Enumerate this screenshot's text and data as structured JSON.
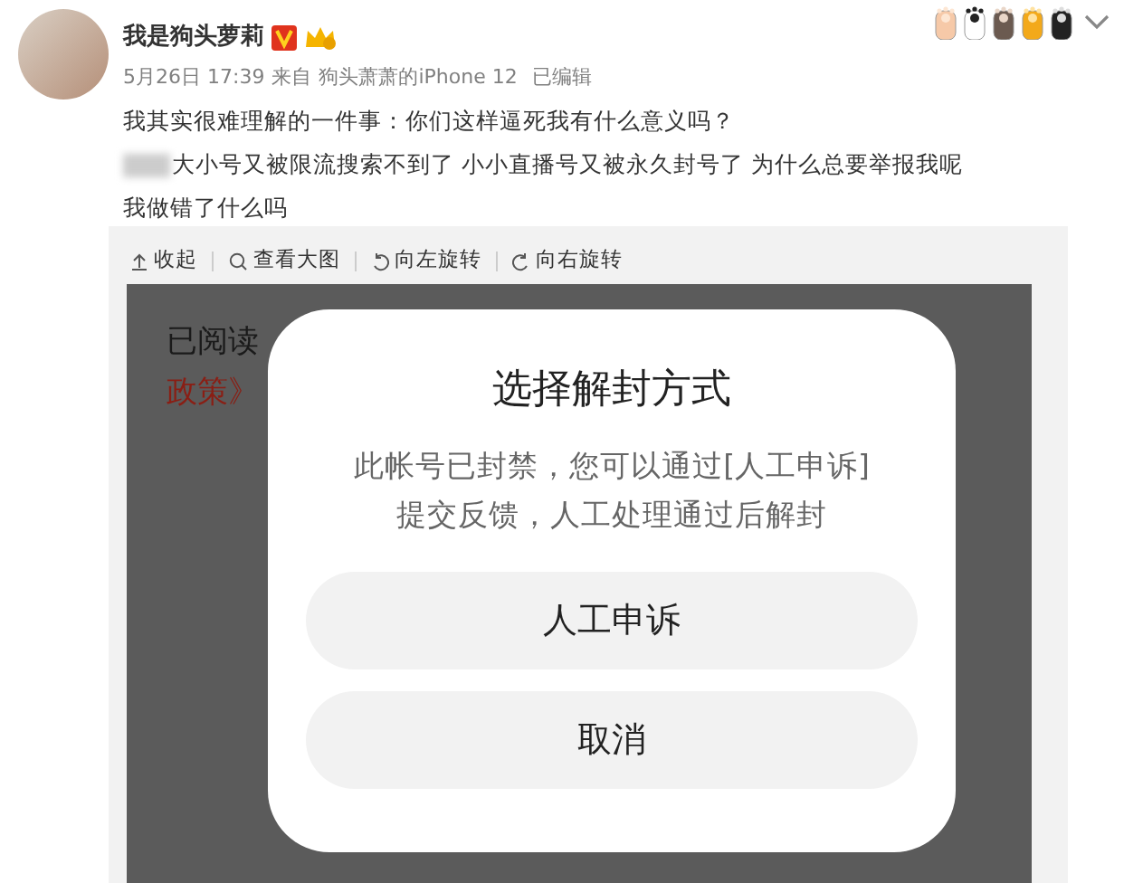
{
  "post": {
    "author": "我是狗头萝莉",
    "time": "5月26日 17:39",
    "source_prefix": "来自",
    "source": "狗头萧萧的iPhone 12",
    "edited": "已编辑",
    "lines": [
      "我其实很难理解的一件事：你们这样逼死我有什么意义吗？",
      "大小号又被限流搜索不到了 小小直播号又被永久封号了 为什么总要举报我呢",
      "我做错了什么吗"
    ]
  },
  "toolbar": [
    "收起",
    "查看大图",
    "向左旋转",
    "向右旋转"
  ],
  "image": {
    "behind_lines": [
      "已阅读",
      "政策》"
    ],
    "dialog": {
      "title": "选择解封方式",
      "message": "此帐号已封禁，您可以通过[人工申诉]提交反馈，人工处理通过后解封",
      "buttons": [
        "人工申诉",
        "取消"
      ]
    }
  }
}
